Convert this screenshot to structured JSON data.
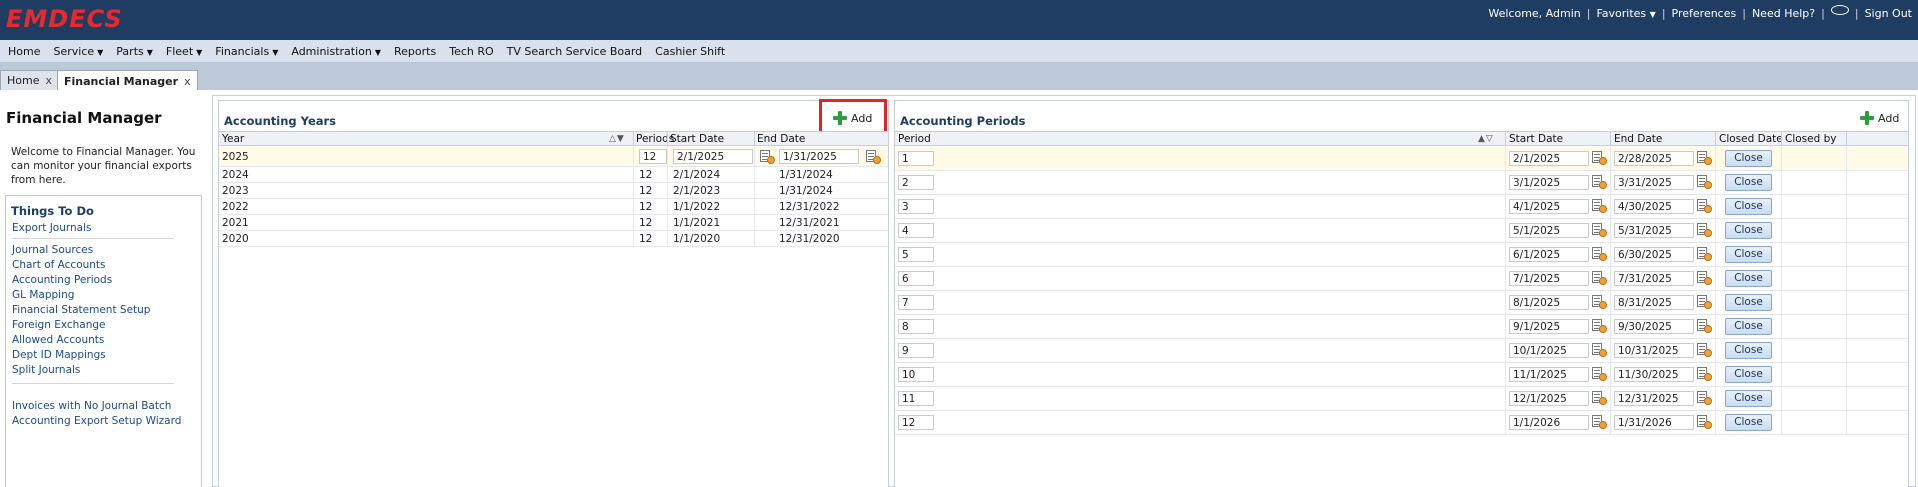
{
  "app": {
    "logo": "EMDECS",
    "welcome": "Welcome, Admin",
    "favorites": "Favorites",
    "preferences": "Preferences",
    "need_help": "Need Help?",
    "sign_out": "Sign Out",
    "brand_color": "#e8292e",
    "header_color": "#1f3d63"
  },
  "menu": [
    {
      "label": "Home",
      "caret": false
    },
    {
      "label": "Service",
      "caret": true
    },
    {
      "label": "Parts",
      "caret": true
    },
    {
      "label": "Fleet",
      "caret": true
    },
    {
      "label": "Financials",
      "caret": true
    },
    {
      "label": "Administration",
      "caret": true
    },
    {
      "label": "Reports",
      "caret": false
    },
    {
      "label": "Tech RO",
      "caret": false
    },
    {
      "label": "TV Search Service Board",
      "caret": false
    },
    {
      "label": "Cashier Shift",
      "caret": false
    }
  ],
  "tabs": [
    {
      "label": "Home",
      "close": "x"
    },
    {
      "label": "Financial Manager",
      "close": "x"
    }
  ],
  "sidebar": {
    "title": "Financial Manager",
    "welcome_text": "Welcome to Financial Manager. You can monitor your financial exports from here.",
    "todo_title": "Things To Do",
    "group1": [
      "Export Journals"
    ],
    "group2": [
      "Journal Sources",
      "Chart of Accounts",
      "Accounting Periods",
      "GL Mapping",
      "Financial Statement Setup",
      "Foreign Exchange",
      "Allowed Accounts",
      "Dept ID Mappings",
      "Split Journals"
    ],
    "group3": [
      "Invoices with No Journal Batch",
      "Accounting Export Setup Wizard"
    ]
  },
  "years_panel": {
    "title": "Accounting Years",
    "add_label": "Add",
    "columns": [
      "Year",
      "Periods",
      "Start Date",
      "End Date"
    ],
    "rows": [
      {
        "year": "2025",
        "periods": "12",
        "start": "2/1/2025",
        "end": "1/31/2025"
      },
      {
        "year": "2024",
        "periods": "12",
        "start": "2/1/2024",
        "end": "1/31/2024"
      },
      {
        "year": "2023",
        "periods": "12",
        "start": "2/1/2023",
        "end": "1/31/2024"
      },
      {
        "year": "2022",
        "periods": "12",
        "start": "1/1/2022",
        "end": "12/31/2022"
      },
      {
        "year": "2021",
        "periods": "12",
        "start": "1/1/2021",
        "end": "12/31/2021"
      },
      {
        "year": "2020",
        "periods": "12",
        "start": "1/1/2020",
        "end": "12/31/2020"
      }
    ]
  },
  "periods_panel": {
    "title": "Accounting Periods",
    "add_label": "Add",
    "columns": [
      "Period",
      "Start Date",
      "End Date",
      "Closed Date",
      "Closed by"
    ],
    "close_label": "Close",
    "rows": [
      {
        "period": "1",
        "start": "2/1/2025",
        "end": "2/28/2025"
      },
      {
        "period": "2",
        "start": "3/1/2025",
        "end": "3/31/2025"
      },
      {
        "period": "3",
        "start": "4/1/2025",
        "end": "4/30/2025"
      },
      {
        "period": "4",
        "start": "5/1/2025",
        "end": "5/31/2025"
      },
      {
        "period": "5",
        "start": "6/1/2025",
        "end": "6/30/2025"
      },
      {
        "period": "6",
        "start": "7/1/2025",
        "end": "7/31/2025"
      },
      {
        "period": "7",
        "start": "8/1/2025",
        "end": "8/31/2025"
      },
      {
        "period": "8",
        "start": "9/1/2025",
        "end": "9/30/2025"
      },
      {
        "period": "9",
        "start": "10/1/2025",
        "end": "10/31/2025"
      },
      {
        "period": "10",
        "start": "11/1/2025",
        "end": "11/30/2025"
      },
      {
        "period": "11",
        "start": "12/1/2025",
        "end": "12/31/2025"
      },
      {
        "period": "12",
        "start": "1/1/2026",
        "end": "1/31/2026"
      }
    ]
  }
}
